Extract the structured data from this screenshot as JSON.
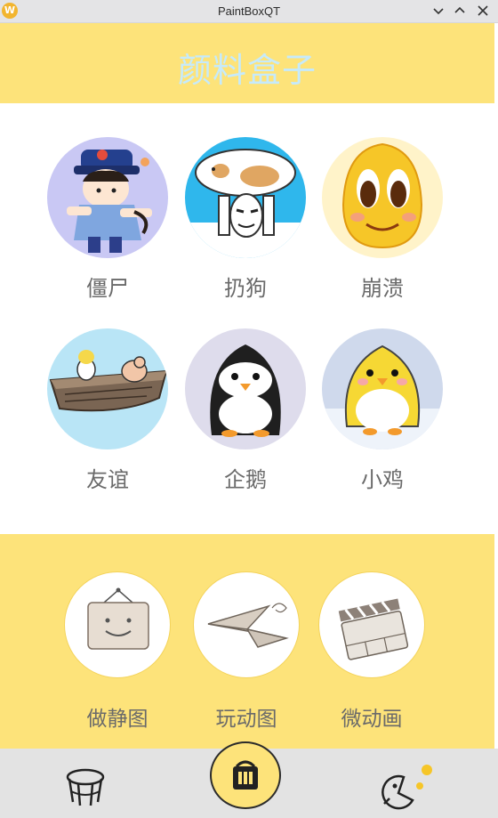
{
  "window": {
    "title": "PaintBoxQT",
    "app_icon_letter": "W"
  },
  "header": {
    "title": "颜料盒子"
  },
  "stickers": [
    {
      "label": "僵尸",
      "icon": "zombie-sticker"
    },
    {
      "label": "扔狗",
      "icon": "throw-dog-sticker"
    },
    {
      "label": "崩溃",
      "icon": "collapse-face-sticker"
    },
    {
      "label": "友谊",
      "icon": "friendship-boat-sticker"
    },
    {
      "label": "企鹅",
      "icon": "penguin-sticker"
    },
    {
      "label": "小鸡",
      "icon": "chick-sticker"
    }
  ],
  "tools": [
    {
      "label": "做静图",
      "icon": "picture-frame-icon"
    },
    {
      "label": "玩动图",
      "icon": "paper-plane-icon"
    },
    {
      "label": "微动画",
      "icon": "clapperboard-icon"
    }
  ],
  "nav": {
    "items": [
      {
        "icon": "stool-icon"
      },
      {
        "icon": "paint-box-icon"
      },
      {
        "icon": "pacman-icon"
      }
    ]
  },
  "colors": {
    "accent_yellow": "#fde37a",
    "header_text": "#c6eafb",
    "label_gray": "#6a6a6a",
    "nav_bg": "#e3e3e3"
  }
}
